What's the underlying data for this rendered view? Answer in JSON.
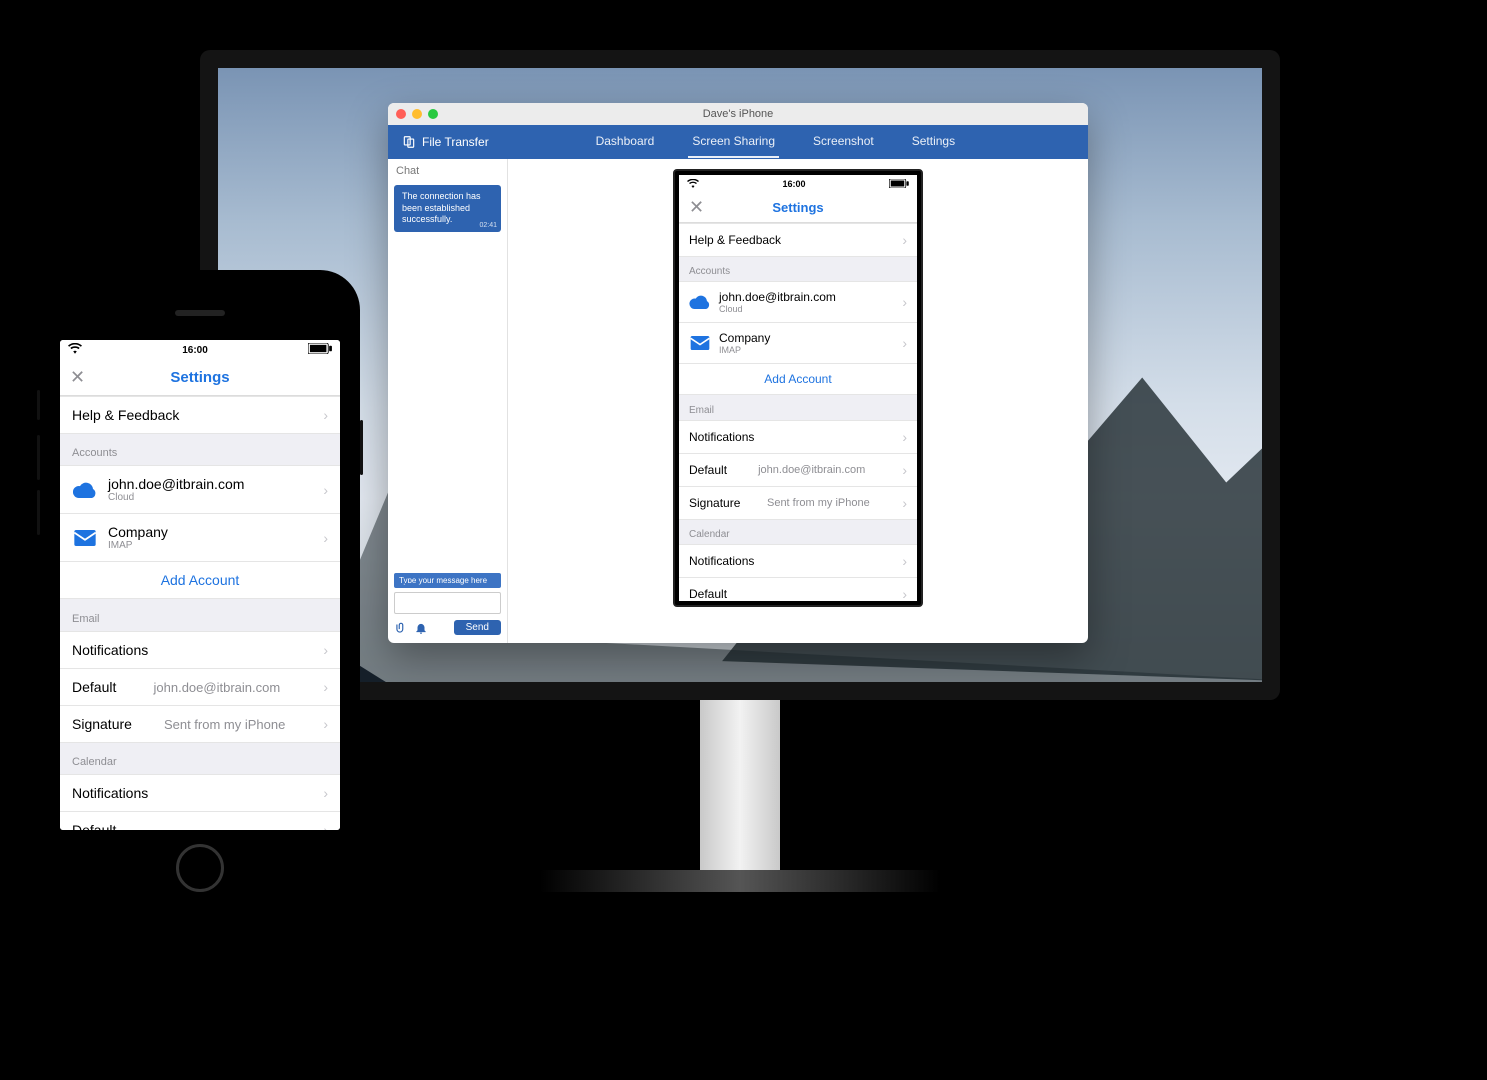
{
  "monitor": {
    "window": {
      "title": "Dave's iPhone",
      "brand": "File Transfer",
      "tabs": [
        "Dashboard",
        "Screen Sharing",
        "Screenshot",
        "Settings"
      ],
      "active_tab": "Screen Sharing"
    },
    "chat": {
      "header": "Chat",
      "bubble_text": "The connection has been established successfully.",
      "bubble_time": "02:41",
      "hint": "Type your message here",
      "send": "Send"
    }
  },
  "phone": {
    "time": "16:00",
    "nav_title": "Settings",
    "rows": {
      "help": "Help & Feedback",
      "accounts_header": "Accounts",
      "account1": {
        "email": "john.doe@itbrain.com",
        "type": "Cloud"
      },
      "account2": {
        "email": "Company",
        "type": "IMAP"
      },
      "add_account": "Add Account",
      "email_header": "Email",
      "notifications": "Notifications",
      "default_label": "Default",
      "default_value": "john.doe@itbrain.com",
      "signature_label": "Signature",
      "signature_value": "Sent from my iPhone",
      "calendar_header": "Calendar",
      "cal_notifications": "Notifications",
      "cal_default": "Default"
    }
  }
}
